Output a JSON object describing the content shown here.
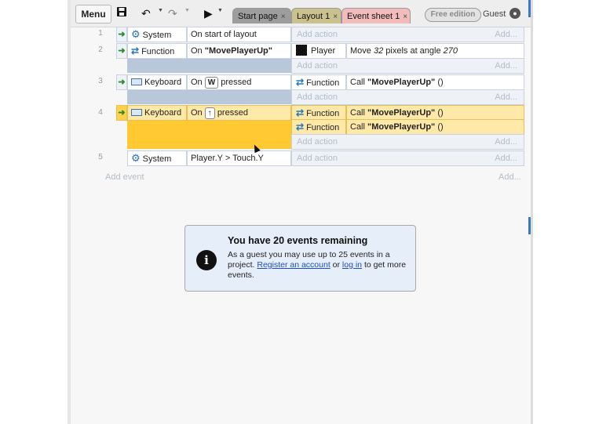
{
  "toolbar": {
    "menu_label": "Menu",
    "icons": [
      "save-icon",
      "undo-icon",
      "redo-icon",
      "play-icon"
    ],
    "tabs": [
      {
        "label": "Start page",
        "close": "×"
      },
      {
        "label": "Layout 1",
        "close": "×"
      },
      {
        "label": "Event sheet 1",
        "close": "×"
      }
    ],
    "edition_badge": "Free edition",
    "user_label": "Guest"
  },
  "events": {
    "e1": {
      "num": "1",
      "object": "System",
      "condition": "On start of layout",
      "add_action": "Add action",
      "add_short": "Add..."
    },
    "e2": {
      "num": "2",
      "object": "Function",
      "cond_prefix": "On ",
      "cond_bold": "\"MovePlayerUp\"",
      "action_object": "Player",
      "action_pre": "Move ",
      "action_num": "32",
      "action_mid": " pixels at angle ",
      "action_angle": "270",
      "add_action": "Add action",
      "add_short": "Add..."
    },
    "e3": {
      "num": "3",
      "object": "Keyboard",
      "cond_prefix": "On",
      "cond_key": "W",
      "cond_suffix": "pressed",
      "action_object": "Function",
      "action_pre": "Call ",
      "action_bold": "\"MovePlayerUp\"",
      "action_post": " ()",
      "add_action": "Add action",
      "add_short": "Add..."
    },
    "e4": {
      "num": "4",
      "object": "Keyboard",
      "cond_prefix": "On",
      "cond_key": "↑",
      "cond_suffix": "pressed",
      "actions": [
        {
          "object": "Function",
          "pre": "Call ",
          "bold": "\"MovePlayerUp\"",
          "post": " ()"
        },
        {
          "object": "Function",
          "pre": "Call ",
          "bold": "\"MovePlayerUp\"",
          "post": " ()"
        }
      ],
      "add_action": "Add action",
      "add_short": "Add..."
    },
    "e5": {
      "num": "5",
      "object": "System",
      "condition": "Player.Y > Touch.Y",
      "add_action": "Add action",
      "add_short": "Add..."
    }
  },
  "add_event": {
    "label": "Add event",
    "short": "Add..."
  },
  "notice": {
    "icon": "info-icon",
    "title": "You have 20 events remaining",
    "body_start": "As a guest you may use up to 25 events in a project. ",
    "link_register": "Register an account",
    "body_mid": " or ",
    "link_login": "log in",
    "body_end": " to get more events."
  },
  "colors": {
    "highlight": "#ffc933",
    "notice_bg": "#e6eefa",
    "link": "#1a4fc2"
  }
}
